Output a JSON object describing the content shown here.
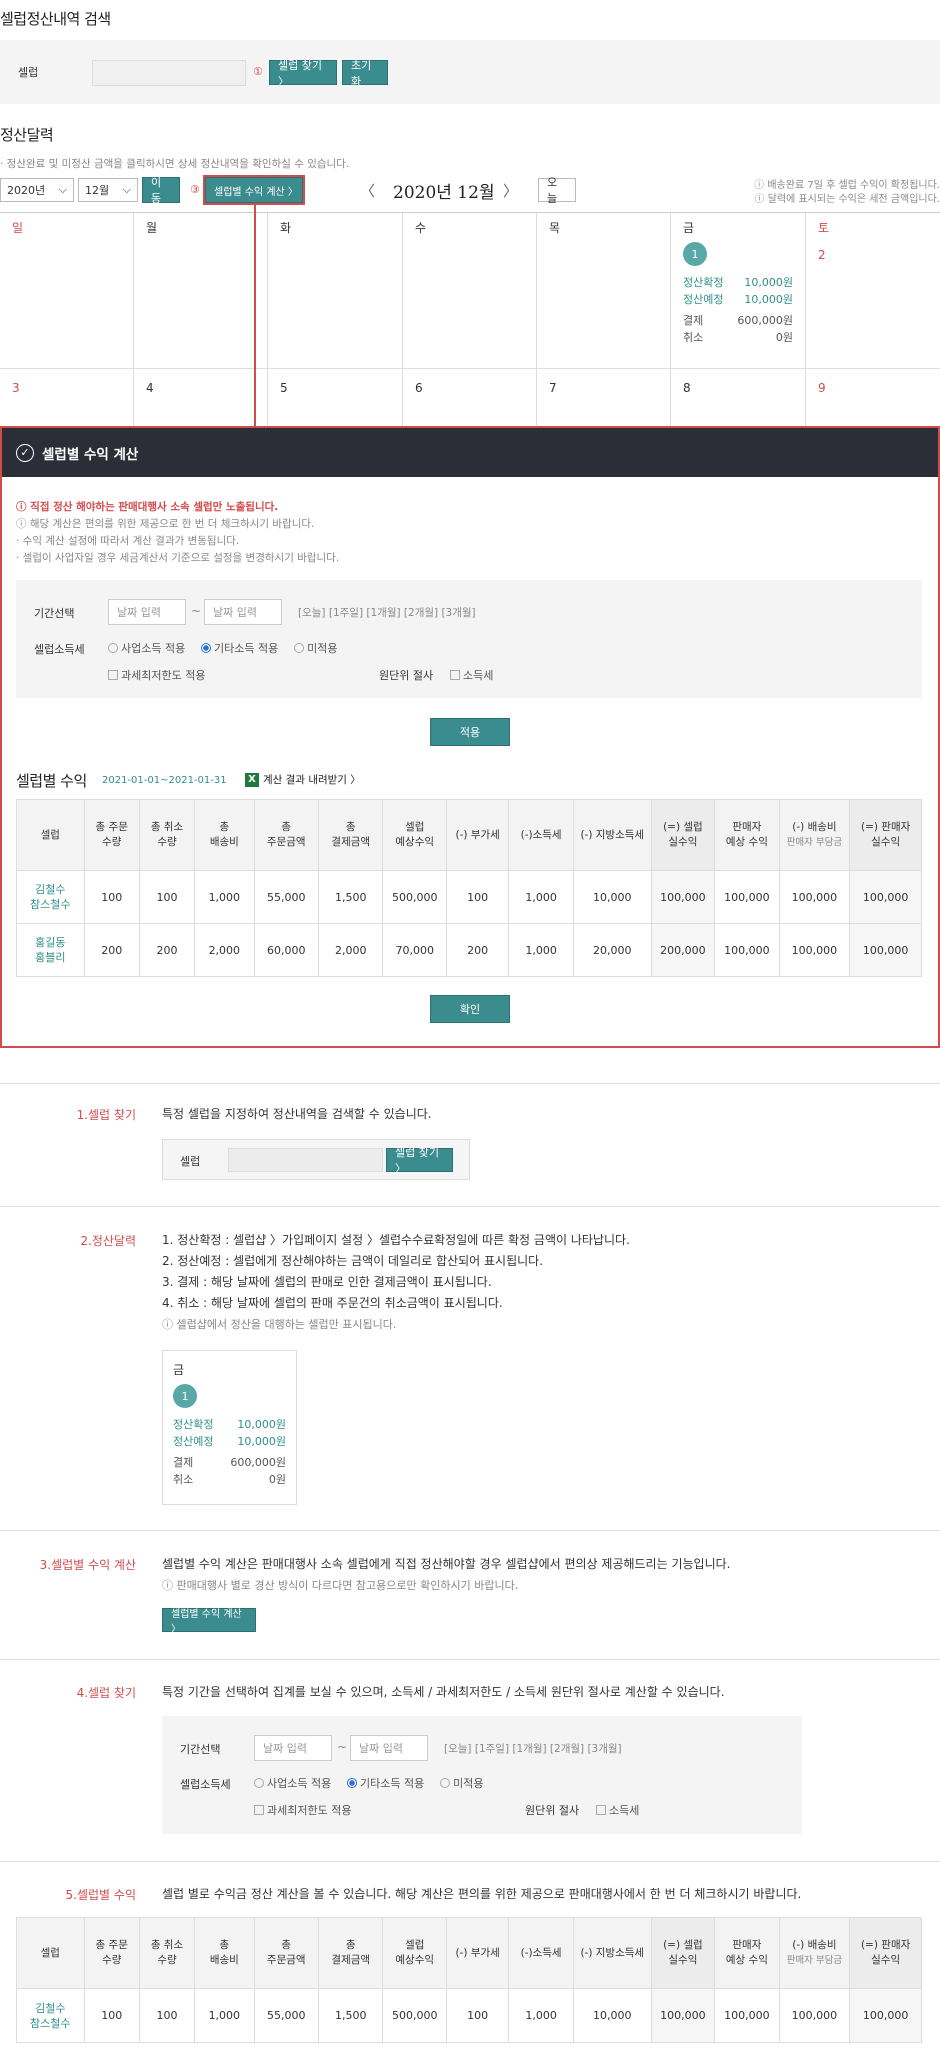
{
  "search": {
    "title": "셀럽정산내역 검색",
    "label": "셀럽",
    "marker": "①",
    "find_btn": "셀럽 찾기 〉",
    "reset_btn": "초기화"
  },
  "calendar": {
    "title": "정산달력",
    "desc": "· 정산완료 및 미정산 금액을 클릭하시면 상세 정산내역을 확인하실 수 있습니다.",
    "year": "2020년",
    "month": "12월",
    "move_btn": "이동",
    "marker": "③",
    "calc_btn": "셀럽별 수익 계산 〉",
    "prev": "〈",
    "next": "〉",
    "current": "2020년 12월",
    "today_btn": "오늘",
    "notes": [
      "ⓘ 배송완료 7일 후 셀럽 수익이 확정됩니다.",
      "ⓘ 달력에 표시되는 수익은 세전 금액입니다."
    ],
    "weekdays": [
      "일",
      "월",
      "화",
      "수",
      "목",
      "금",
      "토"
    ],
    "week1": [
      "",
      "",
      "",
      "",
      "",
      "1",
      "2"
    ],
    "week2": [
      "3",
      "4",
      "5",
      "6",
      "7",
      "8",
      "9"
    ],
    "entry": {
      "confirm_label": "정산확정",
      "confirm_val": "10,000원",
      "expect_label": "정산예정",
      "expect_val": "10,000원",
      "pay_label": "결제",
      "pay_val": "600,000원",
      "cancel_label": "취소",
      "cancel_val": "0원"
    }
  },
  "modal": {
    "title": "셀럽별 수익 계산",
    "notice_red": "ⓘ 직접 정산 해야하는 판매대행사 소속 셀럽만 노출됩니다.",
    "notices": [
      "ⓘ 해당 계산은 편의를 위한 제공으로 한 번 더 체크하시기 바랍니다.",
      "· 수익 계산 설정에 따라서 계산 결과가 변동됩니다.",
      "· 셀럽이 사업자일 경우 세금계산서 기준으로 설정을 변경하시기 바랍니다."
    ],
    "period_label": "기간선택",
    "date_ph": "날짜 입력",
    "tilde": "~",
    "quick": "[오늘] [1주일] [1개월] [2개월] [3개월]",
    "income_label": "셀럽소득세",
    "opt1": "사업소득 적용",
    "opt2": "기타소득 적용",
    "opt3": "미적용",
    "chk1": "과세최저한도 적용",
    "round_label": "원단위 절사",
    "chk2": "소득세",
    "apply_btn": "적용",
    "result_title": "셀럽별 수익",
    "result_range": "2021-01-01~2021-01-31",
    "excel": "계산 결과 내려받기 〉",
    "excel_icon": "X",
    "confirm_btn": "확인"
  },
  "table": {
    "headers": [
      [
        "셀럽"
      ],
      [
        "총 주문",
        "수량"
      ],
      [
        "총 취소",
        "수량"
      ],
      [
        "총",
        "배송비"
      ],
      [
        "총",
        "주문금액"
      ],
      [
        "총",
        "결제금액"
      ],
      [
        "셀럽",
        "예상수익"
      ],
      [
        "(-) 부가세"
      ],
      [
        "(-)소득세"
      ],
      [
        "(-) 지방소득세"
      ],
      [
        "(=) 셀럽",
        "실수익"
      ],
      [
        "판매자",
        "예상 수익"
      ],
      [
        "(-) 배송비",
        "판매자 부담금"
      ],
      [
        "(=) 판매자",
        "실수익"
      ]
    ],
    "rows": [
      {
        "name": [
          "김철수",
          "참스철수"
        ],
        "cells": [
          "100",
          "100",
          "1,000",
          "55,000",
          "1,500",
          "500,000",
          "100",
          "1,000",
          "10,000",
          "100,000",
          "100,000",
          "100,000",
          "100,000"
        ]
      },
      {
        "name": [
          "홍길동",
          "홍블리"
        ],
        "cells": [
          "200",
          "200",
          "2,000",
          "60,000",
          "2,000",
          "70,000",
          "200",
          "1,000",
          "20,000",
          "200,000",
          "100,000",
          "100,000",
          "100,000"
        ]
      }
    ]
  },
  "help": {
    "s1_label": "1.셀럽 찾기",
    "s1_text": "특정 셀럽을 지정하여 정산내역을 검색할 수 있습니다.",
    "s1_field": "셀럽",
    "s1_btn": "셀럽 찾기 〉",
    "s2_label": "2.정산달력",
    "s2_lines": [
      "1. 정산확정 : 셀럽샵 〉가입페이지 설정 〉셀럽수수료확정일에 따른 확정 금액이 나타납니다.",
      "2. 정산예정 : 셀럽에게 정산해야하는 금액이 데일리로 합산되어 표시됩니다.",
      "3. 결제 : 해당 날짜에 셀럽의 판매로 인한 결제금액이 표시됩니다.",
      "4. 취소 : 해당 날짜에 셀럽의 판매 주문건의 취소금액이 표시됩니다."
    ],
    "s2_note": "ⓘ 셀럽샵에서 정산을 대행하는 셀럽만 표시됩니다.",
    "s2_day": "금",
    "s2_num": "1",
    "s3_label": "3.셀럽별 수익 계산",
    "s3_text": "셀럽별 수익 계산은 판매대행사 소속 셀럽에게 직접 정산해야할 경우 셀럽샵에서 편의상 제공해드리는 기능입니다.",
    "s3_note": "ⓘ 판매대행사 별로 경산 방식이 다르다면 참고용으로만 확인하시기 바랍니다.",
    "s3_btn": "셀럽별 수익 계산 〉",
    "s4_label": "4.셀럽 찾기",
    "s4_text": "특정 기간을 선택하여 집계를 보실 수 있으며, 소득세 / 과세최저한도 / 소득세 원단위 절사로 계산할 수 있습니다.",
    "s5_label": "5.셀럽별 수익",
    "s5_text": "셀럽 별로 수익금 정산 계산을 볼 수 있습니다. 해당 계산은 편의를 위한 제공으로 판매대행사에서 한 번 더 체크하시기 바랍니다."
  }
}
